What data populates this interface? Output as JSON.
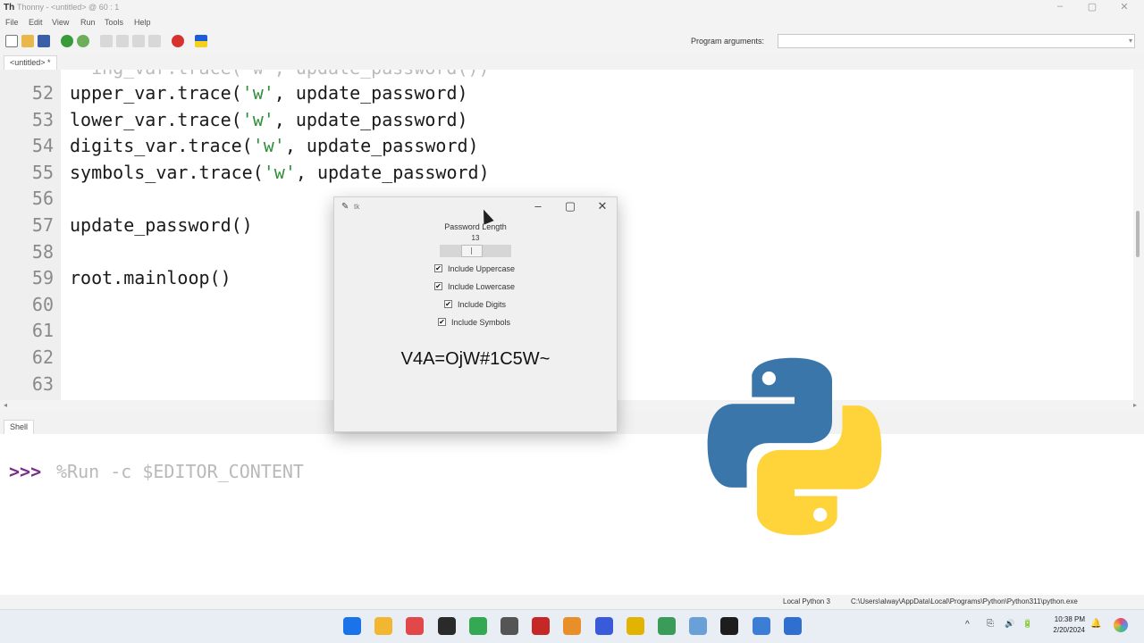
{
  "window": {
    "title": "Thonny - <untitled> @ 60 : 1",
    "logo": "Th",
    "controls": [
      "–",
      "▢",
      "✕"
    ]
  },
  "menu": [
    "File",
    "Edit",
    "View",
    "Run",
    "Tools",
    "Help"
  ],
  "toolbar": {
    "icons": [
      "new-file-icon",
      "open-file-icon",
      "save-icon",
      "run-icon",
      "debug-icon",
      "step-over-icon",
      "step-into-icon",
      "step-out-icon",
      "resume-icon",
      "stop-icon",
      "ukraine-flag-icon"
    ],
    "program_arguments_label": "Program arguments:",
    "program_arguments_value": ""
  },
  "editor": {
    "tab_label": "<untitled> *",
    "ghost_line": "  ing_var.trace('w', update_password())",
    "lines": [
      {
        "num": "52",
        "pre": "upper_var.trace(",
        "str": "'w'",
        "post": ", update_password)"
      },
      {
        "num": "53",
        "pre": "lower_var.trace(",
        "str": "'w'",
        "post": ", update_password)"
      },
      {
        "num": "54",
        "pre": "digits_var.trace(",
        "str": "'w'",
        "post": ", update_password)"
      },
      {
        "num": "55",
        "pre": "symbols_var.trace(",
        "str": "'w'",
        "post": ", update_password)"
      },
      {
        "num": "56",
        "pre": "",
        "str": "",
        "post": ""
      },
      {
        "num": "57",
        "pre": "update_password()",
        "str": "",
        "post": ""
      },
      {
        "num": "58",
        "pre": "",
        "str": "",
        "post": ""
      },
      {
        "num": "59",
        "pre": "root.mainloop()",
        "str": "",
        "post": ""
      },
      {
        "num": "60",
        "pre": "",
        "str": "",
        "post": ""
      },
      {
        "num": "61",
        "pre": "",
        "str": "",
        "post": ""
      },
      {
        "num": "62",
        "pre": "",
        "str": "",
        "post": ""
      },
      {
        "num": "63",
        "pre": "",
        "str": "",
        "post": ""
      }
    ]
  },
  "shell": {
    "tab_label": "Shell",
    "prompt": ">>>",
    "command": "%Run -c $EDITOR_CONTENT"
  },
  "statusbar": {
    "interpreter": "Local Python 3",
    "path": "C:\\Users\\alway\\AppData\\Local\\Programs\\Python\\Python311\\python.exe"
  },
  "popup": {
    "title": "tk",
    "controls": [
      "–",
      "▢",
      "✕"
    ],
    "length_label": "Password Length",
    "length_value": "13",
    "checkboxes": [
      {
        "label": "Include Uppercase",
        "checked": true
      },
      {
        "label": "Include Lowercase",
        "checked": true
      },
      {
        "label": "Include Digits",
        "checked": true
      },
      {
        "label": "Include Symbols",
        "checked": true
      }
    ],
    "check_glyph": "✔",
    "generated_password": "V4A=OjW#1C5W~"
  },
  "taskbar": {
    "apps": [
      {
        "name": "start-icon",
        "color": "#1a73e8"
      },
      {
        "name": "file-explorer-icon",
        "color": "#f2b632"
      },
      {
        "name": "snipping-tool-icon",
        "color": "#e2484a"
      },
      {
        "name": "terminal-icon",
        "color": "#2a2a2a"
      },
      {
        "name": "chrome-icon",
        "color": "#34a853"
      },
      {
        "name": "thonny-icon",
        "color": "#555555"
      },
      {
        "name": "app-icon-red",
        "color": "#c62828"
      },
      {
        "name": "app-icon-paint",
        "color": "#e98f2a"
      },
      {
        "name": "app-icon-blue",
        "color": "#3a5bd9"
      },
      {
        "name": "app-icon-yellow",
        "color": "#e2b300"
      },
      {
        "name": "chrome-profile-icon",
        "color": "#3b9b58"
      },
      {
        "name": "photos-icon",
        "color": "#6aa0d8"
      },
      {
        "name": "media-player-icon",
        "color": "#1d1d1d"
      },
      {
        "name": "calculator-icon",
        "color": "#3c7ed6"
      },
      {
        "name": "tk-window-icon",
        "color": "#2f6fd0"
      }
    ],
    "time": "10:38 PM",
    "date": "2/20/2024",
    "tray": [
      "^",
      "⎘",
      "🔊",
      "🔋",
      "🔔"
    ]
  },
  "python_logo_colors": {
    "blue": "#3b76ab",
    "yellow": "#ffd43b"
  }
}
